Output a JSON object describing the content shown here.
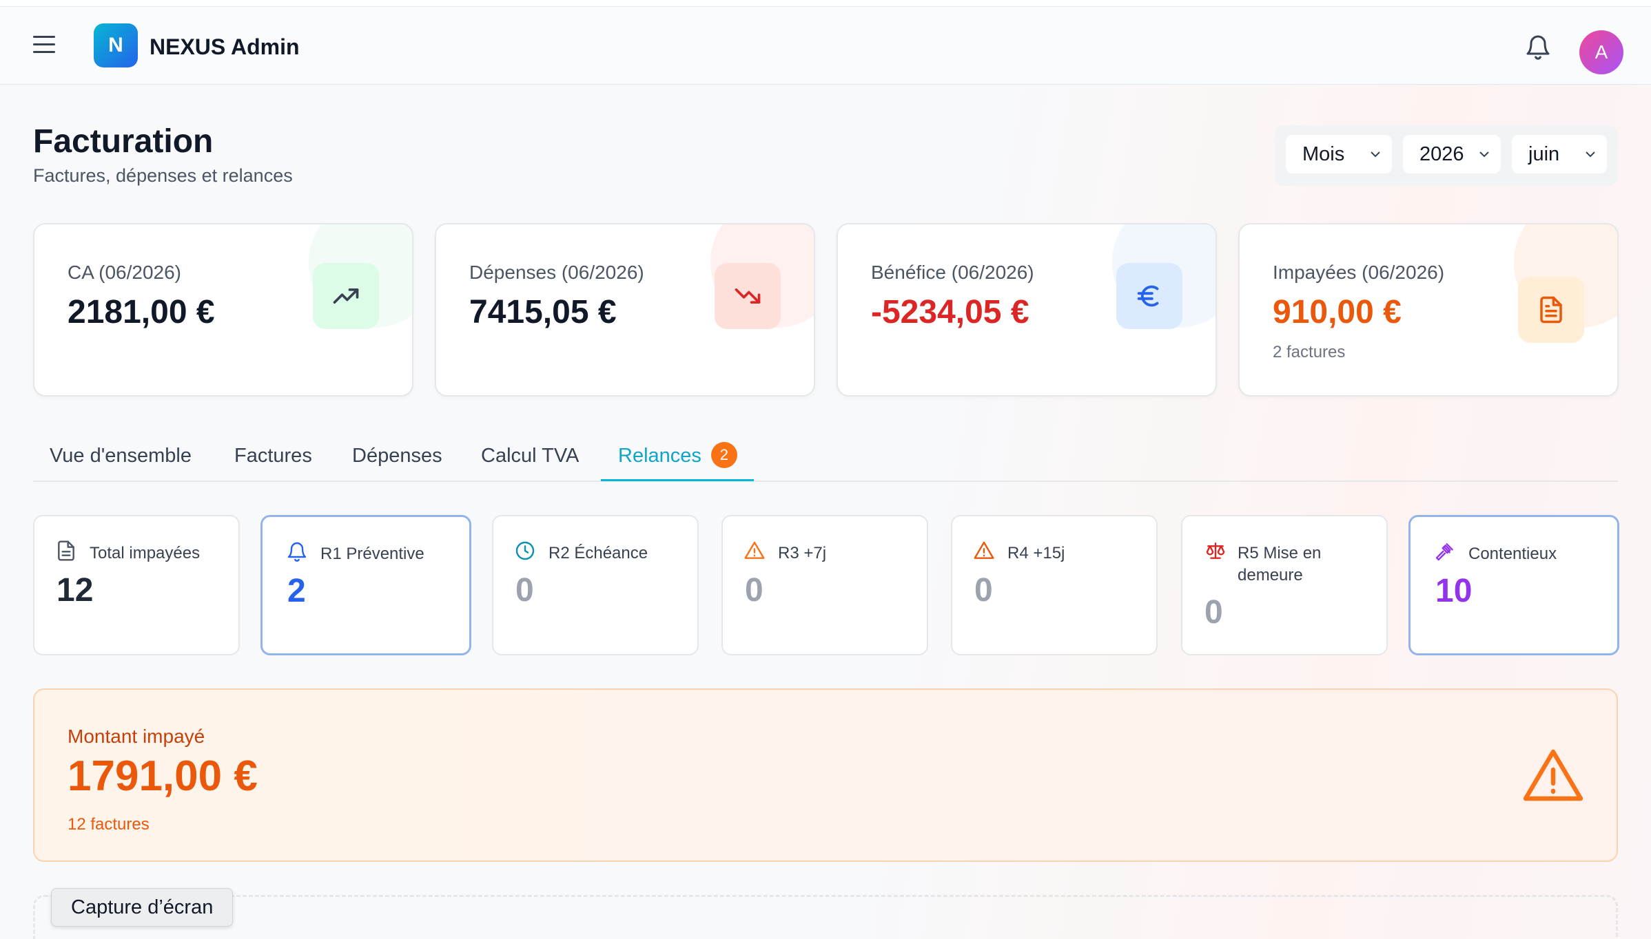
{
  "header": {
    "logo_letter": "N",
    "app_name": "NEXUS Admin",
    "avatar_letter": "A"
  },
  "page": {
    "title": "Facturation",
    "subtitle": "Factures, dépenses et relances"
  },
  "filters": {
    "period": "Mois",
    "year": "2026",
    "month": "juin"
  },
  "kpis": [
    {
      "label": "CA (06/2026)",
      "value": "2181,00 €",
      "icon": "trending-up-icon",
      "value_color": "#111827"
    },
    {
      "label": "Dépenses (06/2026)",
      "value": "7415,05 €",
      "icon": "trending-down-icon",
      "value_color": "#111827"
    },
    {
      "label": "Bénéfice (06/2026)",
      "value": "-5234,05 €",
      "icon": "euro-icon",
      "value_color": "#dc2626"
    },
    {
      "label": "Impayées (06/2026)",
      "value": "910,00 €",
      "note": "2 factures",
      "icon": "document-icon",
      "value_color": "#ea580c"
    }
  ],
  "tabs": [
    {
      "label": "Vue d'ensemble"
    },
    {
      "label": "Factures"
    },
    {
      "label": "Dépenses"
    },
    {
      "label": "Calcul TVA"
    },
    {
      "label": "Relances",
      "badge": "2",
      "active": true
    }
  ],
  "relances": [
    {
      "label": "Total impayées",
      "value": "12",
      "icon": "document-icon",
      "value_color": "#1f2937"
    },
    {
      "label": "R1 Préventive",
      "value": "2",
      "icon": "bell-icon",
      "value_color": "#2563eb",
      "selected": true
    },
    {
      "label": "R2 Échéance",
      "value": "0",
      "icon": "clock-icon",
      "value_color": "#9ca3af"
    },
    {
      "label": "R3 +7j",
      "value": "0",
      "icon": "warning-icon",
      "value_color": "#9ca3af"
    },
    {
      "label": "R4 +15j",
      "value": "0",
      "icon": "warning-icon",
      "value_color": "#9ca3af"
    },
    {
      "label": "R5 Mise en demeure",
      "value": "0",
      "icon": "scale-icon",
      "value_color": "#9ca3af"
    },
    {
      "label": "Contentieux",
      "value": "10",
      "icon": "gavel-icon",
      "value_color": "#9333ea",
      "selected": true
    }
  ],
  "unpaid": {
    "label": "Montant impayé",
    "amount": "1791,00 €",
    "note": "12 factures",
    "icon": "warning-icon"
  },
  "tooltip": {
    "text": "Capture d’écran"
  }
}
